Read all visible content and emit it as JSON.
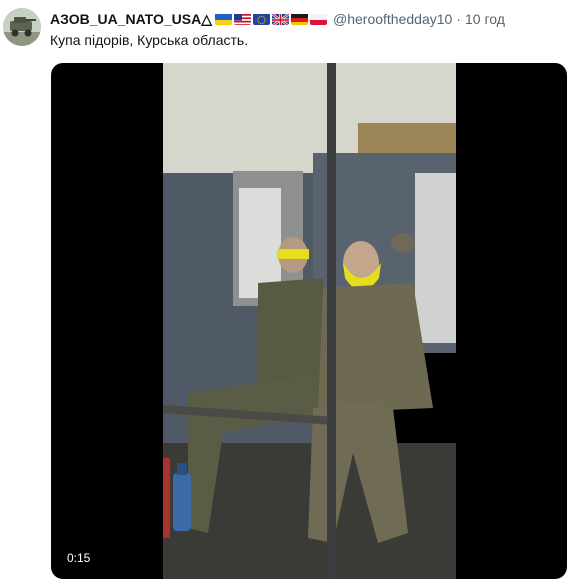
{
  "author": {
    "display_name": "АЗОВ_UA_NATO_USA",
    "name_suffix": "△",
    "flags": [
      "flag-ukraine-icon",
      "flag-usa-icon",
      "flag-eu-icon",
      "flag-uk-icon",
      "flag-germany-icon",
      "flag-poland-icon"
    ],
    "handle": "@heroofthedday10",
    "time_separator": "·",
    "time": "10 год"
  },
  "tweet": {
    "text": "Купа підорів, Курська область."
  },
  "video": {
    "duration": "0:15"
  },
  "colors": {
    "text_primary": "#0f1419",
    "text_secondary": "#536471",
    "video_background": "#000000"
  }
}
